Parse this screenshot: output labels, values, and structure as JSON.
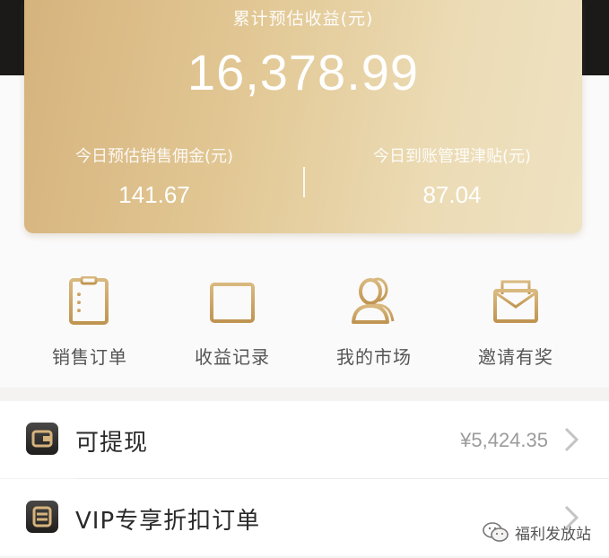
{
  "card": {
    "total_label": "累计预估收益(元)",
    "total_value": "16,378.99",
    "left_label": "今日预估销售佣金(元)",
    "left_value": "141.67",
    "right_label": "今日到账管理津贴(元)",
    "right_value": "87.04"
  },
  "shortcuts": [
    {
      "label": "销售订单",
      "icon": "clipboard-list-icon"
    },
    {
      "label": "收益记录",
      "icon": "calendar-chart-icon"
    },
    {
      "label": "我的市场",
      "icon": "users-icon"
    },
    {
      "label": "邀请有奖",
      "icon": "envelope-icon"
    }
  ],
  "list": [
    {
      "label": "可提现",
      "value": "¥5,424.35",
      "icon": "wallet-icon"
    },
    {
      "label": "VIP专享折扣订单",
      "value": "",
      "icon": "order-icon"
    }
  ],
  "watermark": {
    "text": "福利发放站"
  },
  "colors": {
    "gold_light": "#efe2c2",
    "gold_dark": "#d6b37d",
    "icon_gold": "#c9a566",
    "dark": "#1b1a19"
  }
}
